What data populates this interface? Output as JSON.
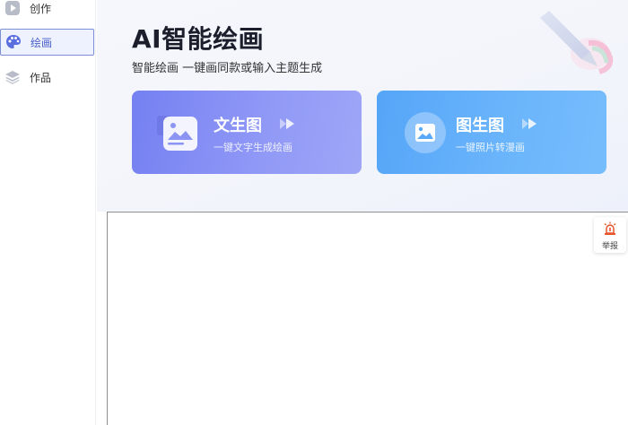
{
  "sidebar": {
    "items": [
      {
        "label": "创作",
        "icon": "play-icon",
        "active": false
      },
      {
        "label": "绘画",
        "icon": "palette-icon",
        "active": true
      },
      {
        "label": "作品",
        "icon": "layers-icon",
        "active": false
      }
    ]
  },
  "header": {
    "title": "AI智能绘画",
    "subtitle": "智能绘画 一键画同款或输入主题生成"
  },
  "cards": [
    {
      "title": "文生图",
      "desc": "一键文字生成绘画",
      "icon": "text-image-icon",
      "color": "#7580f2"
    },
    {
      "title": "图生图",
      "desc": "一键照片转漫画",
      "icon": "photo-icon",
      "color": "#55a5f8"
    }
  ],
  "report": {
    "label": "举报",
    "icon": "alarm-icon",
    "color": "#e8552a"
  },
  "colors": {
    "accent": "#4a5fc8",
    "active_bg": "#eef2ff"
  }
}
